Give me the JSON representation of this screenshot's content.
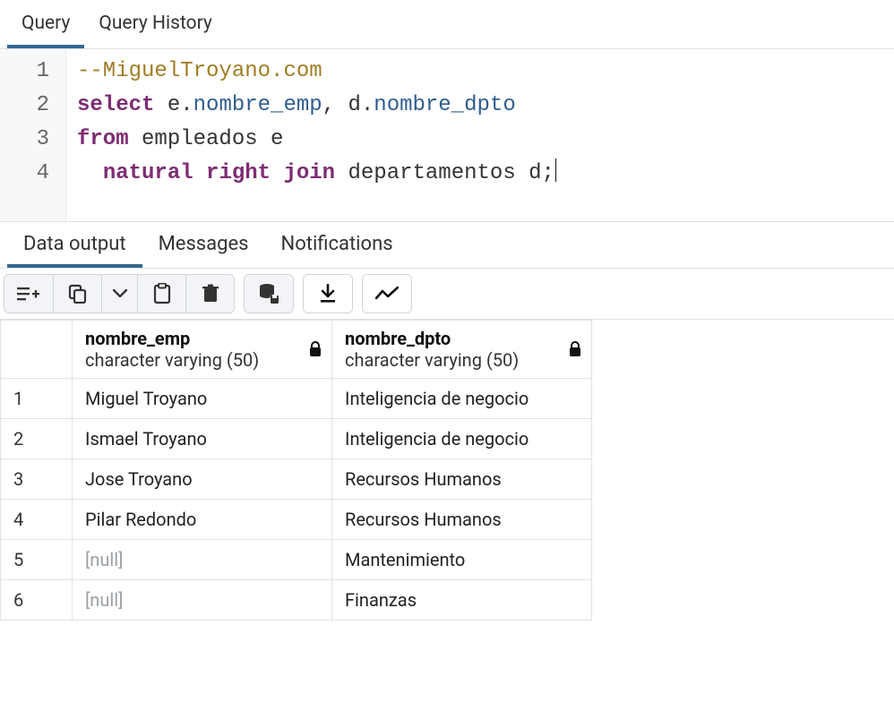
{
  "tabs": {
    "query": "Query",
    "history": "Query History"
  },
  "editor": {
    "lines": [
      "1",
      "2",
      "3",
      "4"
    ],
    "l1_comment": "--MiguelTroyano.com",
    "l2_kw_select": "select",
    "l2_e": "e",
    "l2_nombre_emp": "nombre_emp",
    "l2_d": "d",
    "l2_nombre_dpto": "nombre_dpto",
    "l3_kw_from": "from",
    "l3_empleados": "empleados",
    "l3_alias_e": "e",
    "l4_kw_natural": "natural",
    "l4_kw_right": "right",
    "l4_kw_join": "join",
    "l4_departamentos": "departamentos",
    "l4_alias_d": "d"
  },
  "output_tabs": {
    "data": "Data output",
    "messages": "Messages",
    "notifications": "Notifications"
  },
  "columns": [
    {
      "name": "nombre_emp",
      "type": "character varying (50)"
    },
    {
      "name": "nombre_dpto",
      "type": "character varying (50)"
    }
  ],
  "rows": [
    {
      "n": "1",
      "emp": "Miguel Troyano",
      "dpto": "Inteligencia de negocio"
    },
    {
      "n": "2",
      "emp": "Ismael Troyano",
      "dpto": "Inteligencia de negocio"
    },
    {
      "n": "3",
      "emp": "Jose Troyano",
      "dpto": "Recursos Humanos"
    },
    {
      "n": "4",
      "emp": "Pilar Redondo",
      "dpto": "Recursos Humanos"
    },
    {
      "n": "5",
      "emp": "[null]",
      "dpto": "Mantenimiento"
    },
    {
      "n": "6",
      "emp": "[null]",
      "dpto": "Finanzas"
    }
  ]
}
